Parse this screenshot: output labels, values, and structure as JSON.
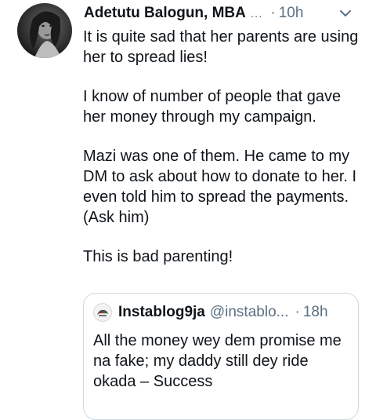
{
  "tweet": {
    "author_name": "Adetutu Balogun, MBA",
    "name_overflow": "...",
    "dot": "·",
    "time": "10h",
    "paragraphs": [
      "It is quite sad that her parents are using her to spread lies!",
      "I know of number of people that gave her money through my campaign.",
      "Mazi was one of them. He came to my DM to ask about how to donate to her. I even told him to spread the payments. (Ask him)",
      "This is bad parenting!"
    ]
  },
  "quoted_tweet": {
    "name": "Instablog9ja",
    "handle": "@instablo...",
    "dot": "·",
    "time": "18h",
    "text": "All the money wey dem promise me na fake; my daddy still dey ride okada – Success"
  },
  "icons": {
    "menu": "chevron-down-icon",
    "quoted_avatar": "instablog9ja-logo-icon"
  },
  "colors": {
    "text": "#0f1419",
    "secondary": "#5b7083",
    "border": "#cfd9de"
  }
}
